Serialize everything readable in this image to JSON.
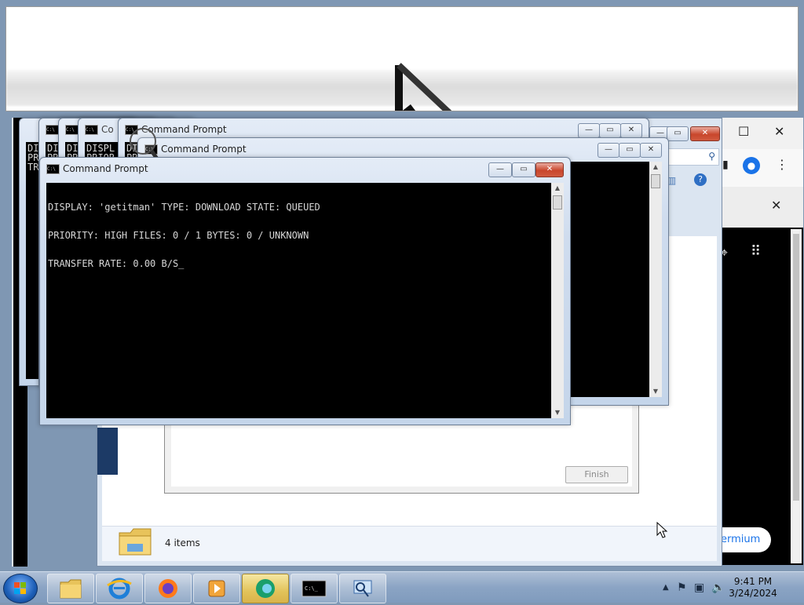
{
  "zoom_view": {
    "content": "magnified mouse pointer"
  },
  "browser": {
    "premium_label": "ermium"
  },
  "explorer": {
    "status_items": "4 items"
  },
  "wizard": {
    "finish_label": "Finish"
  },
  "stacked_cmd": {
    "fragments": [
      "DI\nPR\nTR",
      "DI\nPR",
      "DI\nPR",
      "DISPL\nPRIOR",
      "DI\nPR"
    ]
  },
  "cmd_back": {
    "title": "Command Prompt"
  },
  "cmd_middle": {
    "title": "Command Prompt"
  },
  "cmd_front": {
    "title": "Command Prompt",
    "lines": [
      "DISPLAY: 'getitman' TYPE: DOWNLOAD STATE: QUEUED",
      "PRIORITY: HIGH FILES: 0 / 1 BYTES: 0 / UNKNOWN",
      "TRANSFER RATE: 0.00 B/S_"
    ]
  },
  "window_controls": {
    "minimize": "—",
    "maximize": "▭",
    "close": "✕"
  },
  "taskbar": {
    "apps": [
      {
        "name": "Windows Explorer",
        "icon": "folder-icon"
      },
      {
        "name": "Internet Explorer",
        "icon": "ie-icon"
      },
      {
        "name": "Firefox",
        "icon": "firefox-icon"
      },
      {
        "name": "Media Player",
        "icon": "media-player-icon"
      },
      {
        "name": "Browser",
        "icon": "edge-icon"
      },
      {
        "name": "Command Prompt",
        "icon": "cmd-icon"
      },
      {
        "name": "Network",
        "icon": "network-search-icon"
      }
    ],
    "time": "9:41 PM",
    "date": "3/24/2024"
  },
  "colors": {
    "terminal_bg": "#000000",
    "terminal_fg": "#d7d7d7",
    "close_red": "#c9462c",
    "taskbar": "#8ba4c4"
  }
}
